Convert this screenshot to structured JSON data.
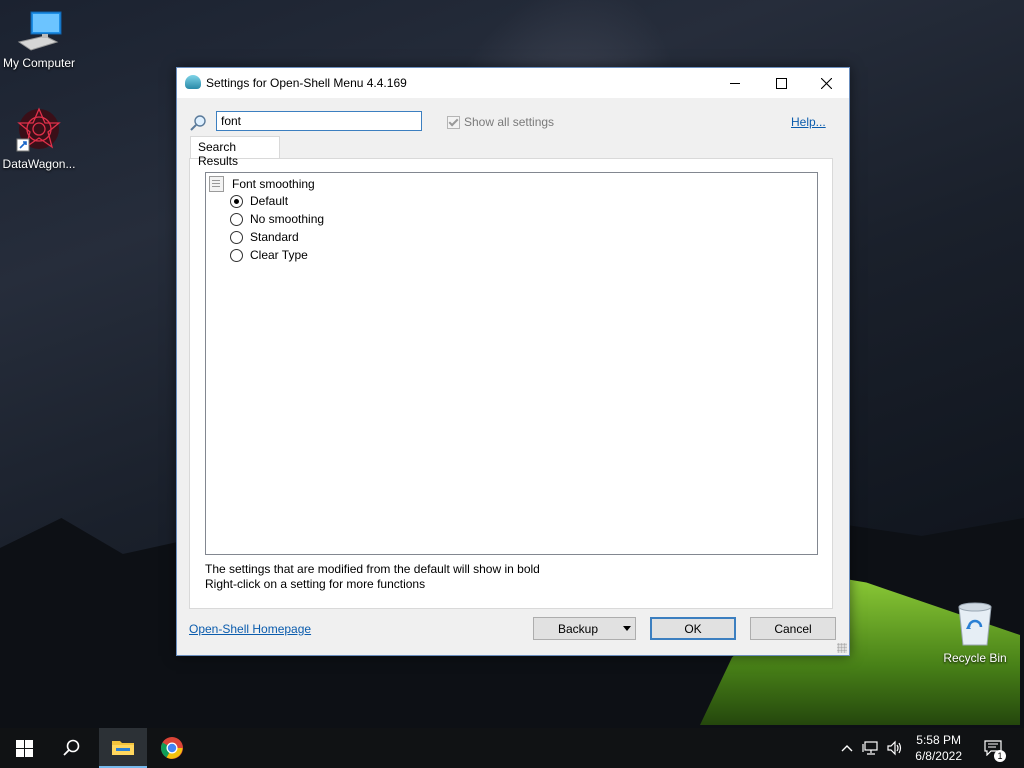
{
  "desktop": {
    "icons": [
      {
        "label": "My Computer"
      },
      {
        "label": "DataWagon..."
      },
      {
        "label": "Recycle Bin"
      }
    ]
  },
  "window": {
    "title": "Settings for Open-Shell Menu 4.4.169",
    "search_value": "font",
    "show_all_label": "Show all settings",
    "help_label": "Help...",
    "tab_label": "Search Results",
    "setting": {
      "label": "Font smoothing",
      "options": [
        {
          "label": "Default",
          "selected": true
        },
        {
          "label": "No smoothing",
          "selected": false
        },
        {
          "label": "Standard",
          "selected": false
        },
        {
          "label": "Clear Type",
          "selected": false
        }
      ]
    },
    "note_line1": "The settings that are modified from the default will show in bold",
    "note_line2": "Right-click on a setting for more functions",
    "homepage_label": "Open-Shell Homepage",
    "buttons": {
      "backup": "Backup",
      "ok": "OK",
      "cancel": "Cancel"
    }
  },
  "taskbar": {
    "time": "5:58 PM",
    "date": "6/8/2022",
    "notification_count": "1"
  },
  "colors": {
    "accent": "#3c7fc0",
    "link": "#0b5cad",
    "taskbar": "#101214"
  }
}
